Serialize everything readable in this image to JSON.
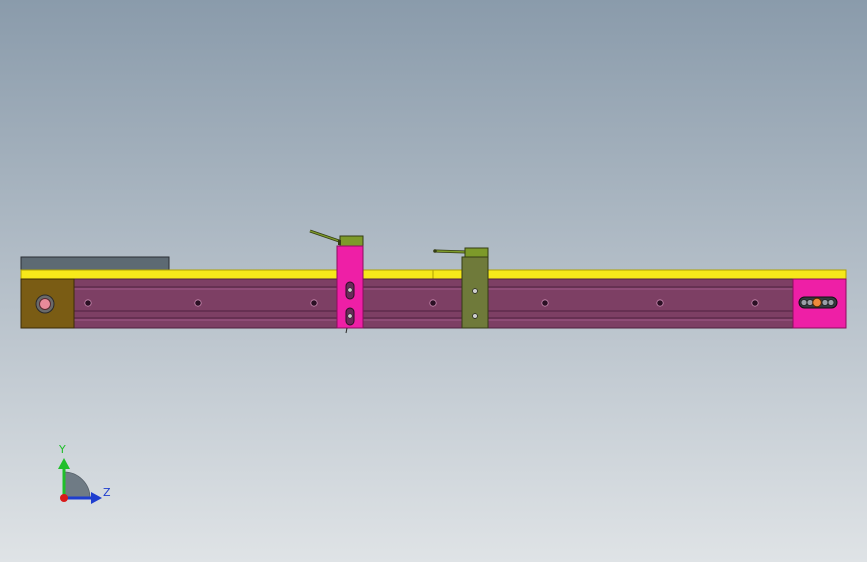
{
  "viewport": {
    "background_top": "#8a9bab",
    "background_bottom": "#dfe3e6"
  },
  "colors": {
    "yellow_rail": "#f6e81a",
    "yellow_edge": "#b0a100",
    "purple_profile": "#7d3f64",
    "purple_dark": "#4e2240",
    "purple_groove": "#a05a88",
    "brown_endcap": "#7a5c14",
    "brown_edge": "#3c2c06",
    "magenta_block": "#ee1fa6",
    "magenta_dark": "#8c0e5e",
    "olive_block": "#6f7a3a",
    "olive_dark": "#343c14",
    "olive_cap": "#7d9a2a",
    "top_bar": "#5d6a73",
    "top_bar_edge": "#2a2f34",
    "pin_orange": "#ef8a3c",
    "pin_pink": "#e88a9a",
    "axis_x_blue": "#1f3ecf",
    "axis_y_green": "#1fbf2a",
    "axis_origin_red": "#d81a1a"
  },
  "icons": {
    "triad": "coordinate-triad-icon",
    "bolt": "bolt-hole-icon"
  },
  "triad": {
    "y_label": "Y",
    "z_label": "Z"
  }
}
